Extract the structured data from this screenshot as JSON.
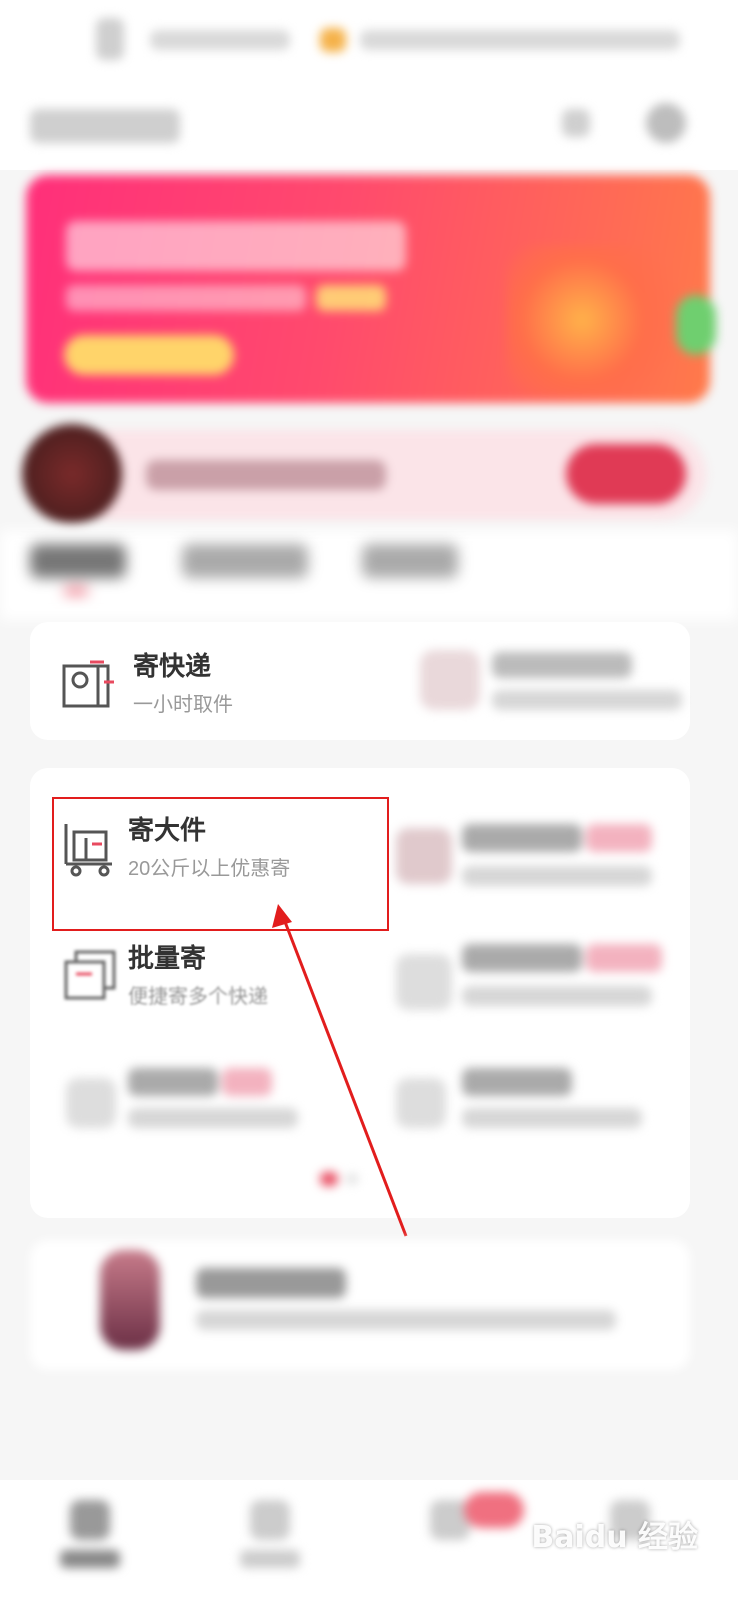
{
  "services": {
    "express": {
      "title": "寄快递",
      "subtitle": "一小时取件"
    },
    "large": {
      "title": "寄大件",
      "subtitle": "20公斤以上优惠寄"
    },
    "batch": {
      "title": "批量寄",
      "subtitle": "便捷寄多个快递"
    }
  },
  "annotation": {
    "highlight_color": "#e21d1d",
    "arrow_color": "#e21d1d"
  },
  "watermark": {
    "text": "Baidu 经验"
  },
  "colors": {
    "banner_start": "#ff2f7a",
    "banner_end": "#ff7a4a",
    "accent": "#e84a5f"
  }
}
